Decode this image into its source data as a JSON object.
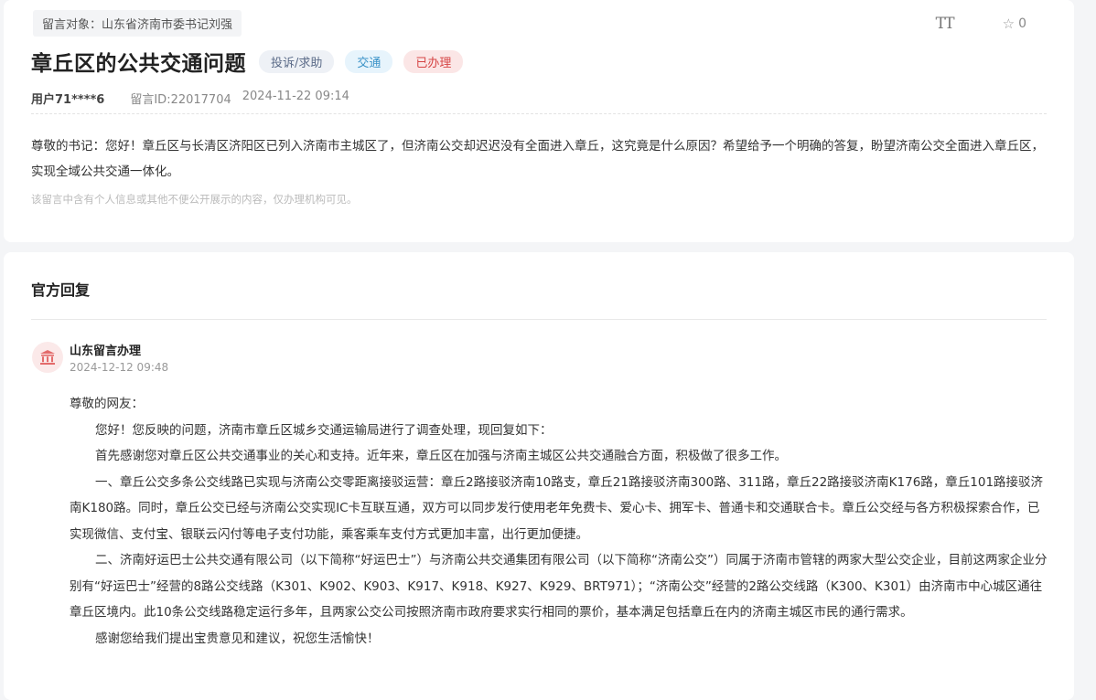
{
  "message": {
    "target_label": "留言对象：山东省济南市委书记刘强",
    "font_tool": "TT",
    "fav_count": "0",
    "title": "章丘区的公共交通问题",
    "tags": [
      "投诉/求助",
      "交通",
      "已办理"
    ],
    "user": "用户71****6",
    "message_id": "留言ID:22017704",
    "datetime": "2024-11-22 09:14",
    "body": "尊敬的书记：您好！章丘区与长清区济阳区已列入济南市主城区了，但济南公交却迟迟没有全面进入章丘，这究竟是什么原因？希望给予一个明确的答复，盼望济南公交全面进入章丘区，实现全域公共交通一体化。",
    "privacy_note": "该留言中含有个人信息或其他不便公开展示的内容，仅办理机构可见。"
  },
  "reply": {
    "section_title": "官方回复",
    "org_name": "山东留言办理",
    "date": "2024-12-12 09:48",
    "paragraphs": [
      "尊敬的网友：",
      "您好！您反映的问题，济南市章丘区城乡交通运输局进行了调查处理，现回复如下：",
      "首先感谢您对章丘区公共交通事业的关心和支持。近年来，章丘区在加强与济南主城区公共交通融合方面，积极做了很多工作。",
      "一、章丘公交多条公交线路已实现与济南公交零距离接驳运营：章丘2路接驳济南10路支，章丘21路接驳济南300路、311路，章丘22路接驳济南K176路，章丘101路接驳济南K180路。同时，章丘公交已经与济南公交实现IC卡互联互通，双方可以同步发行使用老年免费卡、爱心卡、拥军卡、普通卡和交通联合卡。章丘公交经与各方积极探索合作，已实现微信、支付宝、银联云闪付等电子支付功能，乘客乘车支付方式更加丰富，出行更加便捷。",
      "二、济南好运巴士公共交通有限公司（以下简称“好运巴士”）与济南公共交通集团有限公司（以下简称“济南公交”）同属于济南市管辖的两家大型公交企业，目前这两家企业分别有“好运巴士”经营的8路公交线路（K301、K902、K903、K917、K918、K927、K929、BRT971）；“济南公交”经营的2路公交线路（K300、K301）由济南市中心城区通往章丘区境内。此10条公交线路稳定运行多年，且两家公交公司按照济南市政府要求实行相同的票价，基本满足包括章丘在内的济南主城区市民的通行需求。",
      "感谢您给我们提出宝贵意见和建议，祝您生活愉快！"
    ]
  },
  "colors": {
    "tag_status_bg": "#fbe6e6",
    "tag_status_text": "#d64545",
    "tag_type_text": "#5b6b88",
    "tag_category_text": "#3a92c7",
    "avatar_icon": "#e36b6b"
  },
  "icons": {
    "font_size_tool": "font-size-icon",
    "favorite": "star-icon",
    "org_avatar": "government-building-icon"
  }
}
